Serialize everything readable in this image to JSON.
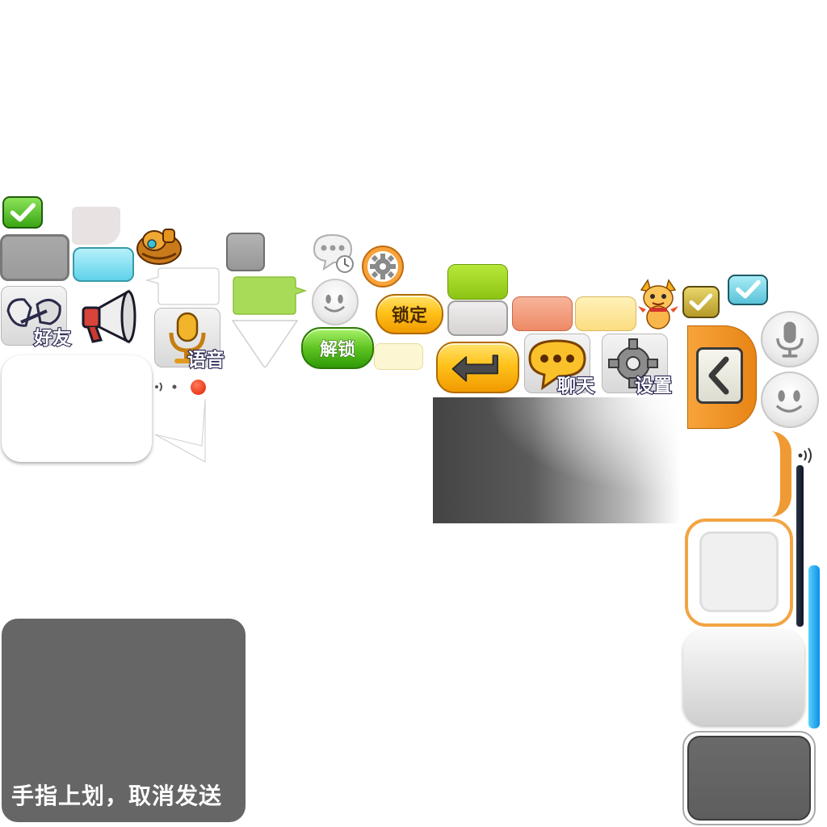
{
  "labels": {
    "friends": "好友",
    "voice": "语音",
    "chat": "聊天",
    "settings": "设置",
    "lock": "锁定",
    "unlock": "解锁",
    "cancel_hint": "手指上划，取消发送"
  },
  "icons": {
    "check_green": "check-icon",
    "check_olive": "check-icon",
    "check_teal": "check-icon",
    "backpack": "backpack-icon",
    "chat_history": "chat-history-icon",
    "gear_small": "gear-icon",
    "smiley": "smiley-icon",
    "enter": "enter-arrow-icon",
    "back": "chevron-left-icon",
    "mic": "microphone-icon",
    "megaphone": "megaphone-icon",
    "signal": "signal-wave-icon",
    "dragon": "dragon-mascot-icon"
  },
  "colors": {
    "green": "#5fc421",
    "teal": "#7ed6e6",
    "olive": "#c7b24a",
    "orange": "#f2962c",
    "salmon": "#f29a7a",
    "pale_yellow": "#fde8a0",
    "lime": "#a6dc20",
    "gray_dark": "#666666",
    "blue": "#1aa7ee"
  }
}
